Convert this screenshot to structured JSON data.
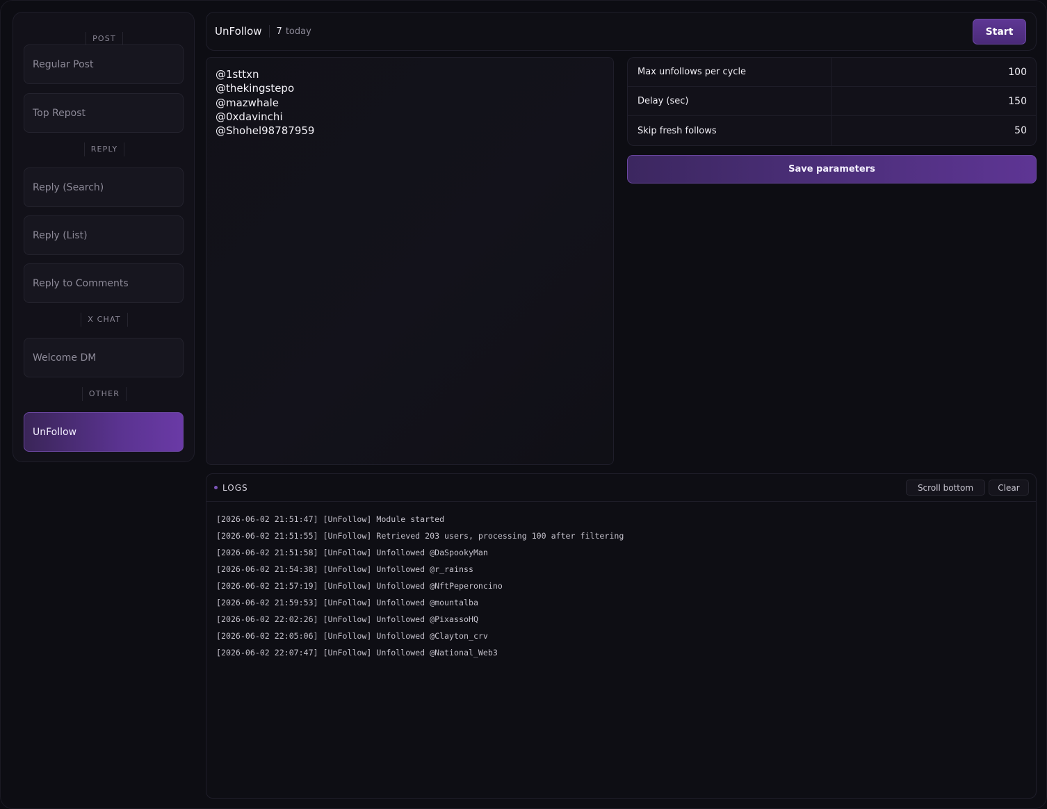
{
  "sidebar": {
    "sections": [
      {
        "label": "POST",
        "items": [
          "Regular Post",
          "Top Repost"
        ]
      },
      {
        "label": "REPLY",
        "items": [
          "Reply (Search)",
          "Reply (List)",
          "Reply to Comments"
        ]
      },
      {
        "label": "X CHAT",
        "items": [
          "Welcome DM"
        ]
      },
      {
        "label": "OTHER",
        "items": [
          "UnFollow"
        ]
      }
    ],
    "active_item": "UnFollow"
  },
  "header": {
    "title": "UnFollow",
    "count": "7",
    "count_label": "today",
    "start_label": "Start"
  },
  "targets": {
    "text": "@1sttxn\n@thekingstepo\n@mazwhale\n@0xdavinchi\n@Shohel98787959"
  },
  "params": [
    {
      "label": "Max unfollows per cycle",
      "value": "100"
    },
    {
      "label": "Delay (sec)",
      "value": "150"
    },
    {
      "label": "Skip fresh follows",
      "value": "50"
    }
  ],
  "save_label": "Save parameters",
  "logs": {
    "title": "LOGS",
    "scroll_label": "Scroll bottom",
    "clear_label": "Clear",
    "lines": [
      "[2026-06-02 21:51:47] [UnFollow] Module started",
      "[2026-06-02 21:51:55] [UnFollow] Retrieved 203 users, processing 100 after filtering",
      "[2026-06-02 21:51:58] [UnFollow] Unfollowed @DaSpookyMan",
      "[2026-06-02 21:54:38] [UnFollow] Unfollowed @r_rainss",
      "[2026-06-02 21:57:19] [UnFollow] Unfollowed @NftPeperoncino",
      "[2026-06-02 21:59:53] [UnFollow] Unfollowed @mountalba",
      "[2026-06-02 22:02:26] [UnFollow] Unfollowed @PixassoHQ",
      "[2026-06-02 22:05:06] [UnFollow] Unfollowed @Clayton_crv",
      "[2026-06-02 22:07:47] [UnFollow] Unfollowed @National_Web3"
    ]
  }
}
